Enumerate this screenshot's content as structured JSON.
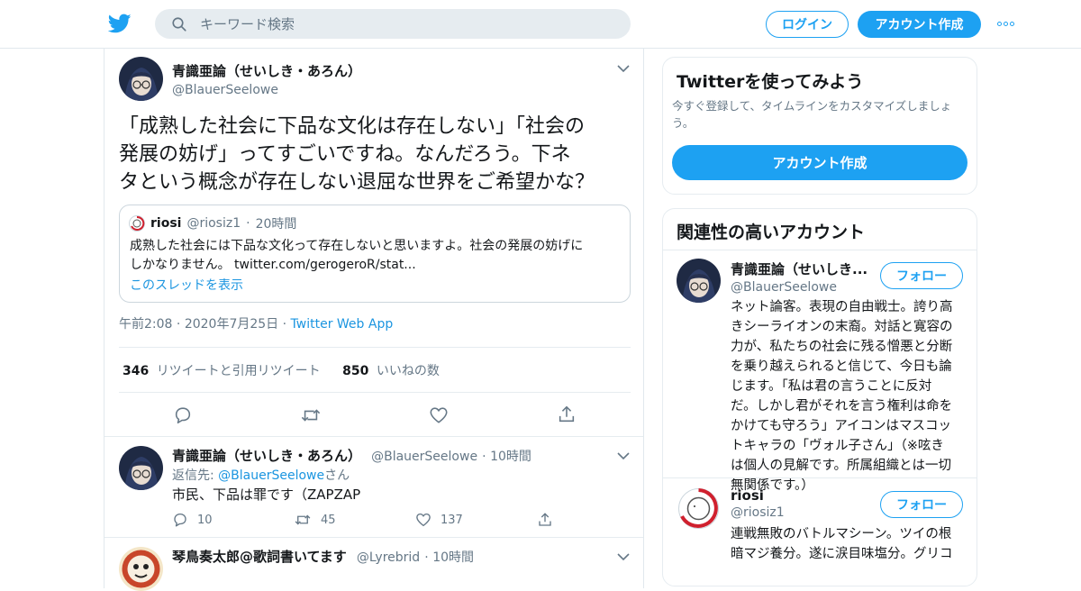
{
  "header": {
    "search_placeholder": "キーワード検索",
    "login_label": "ログイン",
    "signup_label": "アカウント作成",
    "accent_color": "#1da1f2"
  },
  "tweet": {
    "author_name": "青識亜論（せいしき・あろん）",
    "author_handle": "@BlauerSeelowe",
    "text_line1": "「成熟した社会に下品な文化は存在しない」「社会の",
    "text_line2": "発展の妨げ」ってすごいですね。なんだろう。下ネ",
    "text_line3": "タという概念が存在しない退屈な世界をご希望かな？",
    "quote": {
      "name": "riosi",
      "handle": "@riosiz1",
      "time": "20時間",
      "text_line1": "成熟した社会には下品な文化って存在しないと思いますよ。社会の発展の妨げに",
      "text_line2": "しかなりません。 twitter.com/gerogeroR/stat...",
      "thread_link": "このスレッドを表示"
    },
    "time": "午前2:08",
    "date": "2020年7月25日",
    "source": "Twitter Web App",
    "retweets_count": "346",
    "retweets_label": "リツイートと引用リツイート",
    "likes_count": "850",
    "likes_label": "いいねの数"
  },
  "replies": [
    {
      "name": "青識亜論（せいしき・あろん）",
      "handle": "@BlauerSeelowe",
      "time": "10時間",
      "reply_to_prefix": "返信先: ",
      "reply_to_handle": "@BlauerSeelowe",
      "reply_to_suffix": "さん",
      "text": "市民、下品は罪です（ZAPZAP",
      "reply_count": "10",
      "retweet_count": "45",
      "like_count": "137"
    },
    {
      "name": "琴鳥奏太郎@歌詞書いてます",
      "handle": "@Lyrebrid",
      "time": "10時間"
    }
  ],
  "sidebar": {
    "signup_card": {
      "title": "Twitterを使ってみよう",
      "subtitle_line1": "今すぐ登録して、タイムラインをカスタマイズしましょ",
      "subtitle_line2": "う。",
      "button_label": "アカウント作成"
    },
    "related": {
      "title": "関連性の高いアカウント",
      "follow_label": "フォロー",
      "accounts": [
        {
          "name": "青識亜論（せいしき...",
          "handle": "@BlauerSeelowe",
          "bio_lines": [
            "ネット論客。表現の自由戦士。誇り高",
            "きシーライオンの末裔。対話と寛容の",
            "力が、私たちの社会に残る憎悪と分断",
            "を乗り越えられると信じて、今日も論",
            "じます。「私は君の言うことに反対",
            "だ。しかし君がそれを言う権利は命を",
            "かけても守ろう」アイコンはマスコッ",
            "トキャラの「ヴォル子さん」（※呟き",
            "は個人の見解です。所属組織とは一切",
            "無関係です。）"
          ]
        },
        {
          "name": "riosi",
          "handle": "@riosiz1",
          "bio_lines": [
            "連戦無敗のバトルマシーン。ツイの根",
            "暗マジ養分。遂に涙目味塩分。グリコ"
          ]
        }
      ]
    }
  }
}
